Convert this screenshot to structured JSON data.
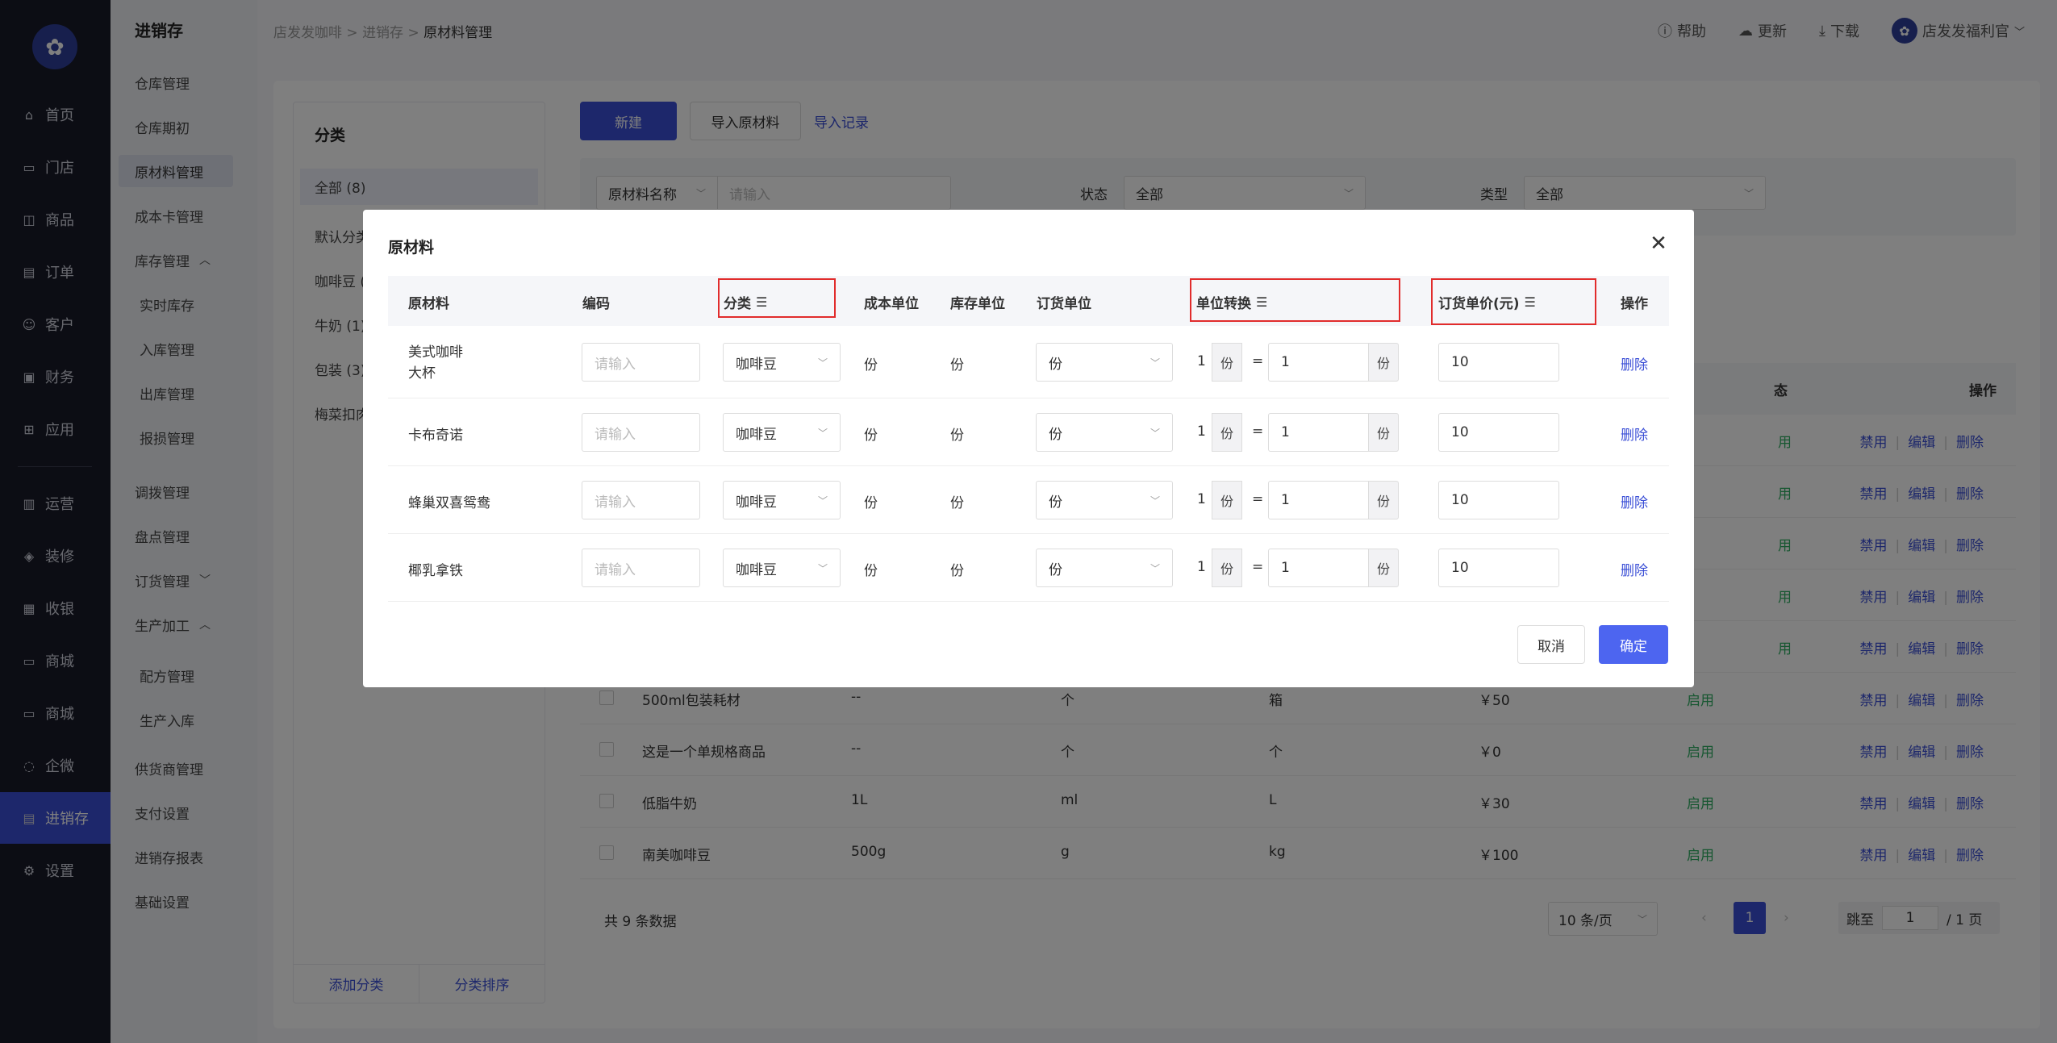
{
  "nav": {
    "items": [
      {
        "label": "首页",
        "icon": "home-icon"
      },
      {
        "label": "门店",
        "icon": "store-icon"
      },
      {
        "label": "商品",
        "icon": "bag-icon"
      },
      {
        "label": "订单",
        "icon": "order-icon"
      },
      {
        "label": "客户",
        "icon": "user-icon"
      },
      {
        "label": "财务",
        "icon": "wallet-icon"
      },
      {
        "label": "应用",
        "icon": "apps-icon"
      },
      {
        "label": "运营",
        "icon": "gift-icon"
      },
      {
        "label": "装修",
        "icon": "layers-icon"
      },
      {
        "label": "收银",
        "icon": "cashier-icon"
      },
      {
        "label": "商城",
        "icon": "shop-icon"
      },
      {
        "label": "商城",
        "icon": "shop-icon"
      },
      {
        "label": "企微",
        "icon": "chat-icon"
      },
      {
        "label": "进销存",
        "icon": "inventory-icon"
      },
      {
        "label": "设置",
        "icon": "gear-icon"
      }
    ]
  },
  "subnav": {
    "title": "进销存",
    "items": [
      "仓库管理",
      "仓库期初",
      "原材料管理",
      "成本卡管理",
      "库存管理",
      "实时库存",
      "入库管理",
      "出库管理",
      "报损管理",
      "调拨管理",
      "盘点管理",
      "订货管理",
      "生产加工",
      "配方管理",
      "生产入库",
      "供货商管理",
      "支付设置",
      "进销存报表",
      "基础设置"
    ]
  },
  "breadcrumb": {
    "root": "店发发咖啡",
    "mid": "进销存",
    "current": "原材料管理",
    "sep": ">"
  },
  "topbar": {
    "help": "帮助",
    "update": "更新",
    "download": "下载",
    "user": "店发发福利官"
  },
  "categories": {
    "title": "分类",
    "items": [
      "全部 (8)",
      "默认分类",
      "咖啡豆 (",
      "牛奶 (1)",
      "包装 (3)",
      "梅菜扣肉"
    ],
    "add": "添加分类",
    "sort": "分类排序"
  },
  "toolbar": {
    "new": "新建",
    "import": "导入原材料",
    "records": "导入记录"
  },
  "filters": {
    "name_label": "原材料名称",
    "name_placeholder": "请输入",
    "status_label": "状态",
    "status_value": "全部",
    "type_label": "类型",
    "type_value": "全部"
  },
  "bg_table": {
    "op_header": "操作",
    "status_header_partial": "态",
    "rows": [
      {
        "name": "500ml包装耗材",
        "spec": "--",
        "unit": "个",
        "order_unit": "箱",
        "price": "￥50",
        "status": "启用"
      },
      {
        "name": "这是一个单规格商品",
        "spec": "--",
        "unit": "个",
        "order_unit": "个",
        "price": "￥0",
        "status": "启用"
      },
      {
        "name": "低脂牛奶",
        "spec": "1L",
        "unit": "ml",
        "order_unit": "L",
        "price": "￥30",
        "status": "启用"
      },
      {
        "name": "南美咖啡豆",
        "spec": "500g",
        "unit": "g",
        "order_unit": "kg",
        "price": "￥100",
        "status": "启用"
      }
    ],
    "status_partial": "用",
    "ops": {
      "disable": "禁用",
      "edit": "编辑",
      "delete": "删除"
    }
  },
  "pager": {
    "total": "共 9 条数据",
    "per_page": "10 条/页",
    "page": "1",
    "goto": "跳至",
    "goto_value": "1",
    "pages": "/ 1 页"
  },
  "modal": {
    "title": "原材料",
    "headers": {
      "material": "原材料",
      "code": "编码",
      "category": "分类",
      "cost_unit": "成本单位",
      "stock_unit": "库存单位",
      "order_unit": "订货单位",
      "conversion": "单位转换",
      "order_price": "订货单价(元)",
      "actions": "操作"
    },
    "code_placeholder": "请输入",
    "eq": "=",
    "rows": [
      {
        "name": "美式咖啡大杯",
        "name_l1": "美式咖啡",
        "name_l2": "大杯",
        "category": "咖啡豆",
        "cost_unit": "份",
        "stock_unit": "份",
        "order_unit": "份",
        "conv_left": "1",
        "conv_left_unit": "份",
        "conv_right": "1",
        "conv_right_unit": "份",
        "price": "10",
        "action": "删除"
      },
      {
        "name": "卡布奇诺",
        "category": "咖啡豆",
        "cost_unit": "份",
        "stock_unit": "份",
        "order_unit": "份",
        "conv_left": "1",
        "conv_left_unit": "份",
        "conv_right": "1",
        "conv_right_unit": "份",
        "price": "10",
        "action": "删除"
      },
      {
        "name": "蜂巢双喜鸳鸯",
        "category": "咖啡豆",
        "cost_unit": "份",
        "stock_unit": "份",
        "order_unit": "份",
        "conv_left": "1",
        "conv_left_unit": "份",
        "conv_right": "1",
        "conv_right_unit": "份",
        "price": "10",
        "action": "删除"
      },
      {
        "name": "椰乳拿铁",
        "category": "咖啡豆",
        "cost_unit": "份",
        "stock_unit": "份",
        "order_unit": "份",
        "conv_left": "1",
        "conv_left_unit": "份",
        "conv_right": "1",
        "conv_right_unit": "份",
        "price": "10",
        "action": "删除"
      }
    ],
    "cancel": "取消",
    "confirm": "确定"
  },
  "colors": {
    "primary": "#3b4fd6",
    "highlight": "#e12c2c",
    "success": "#2fae62",
    "sidebar": "#181a29"
  }
}
